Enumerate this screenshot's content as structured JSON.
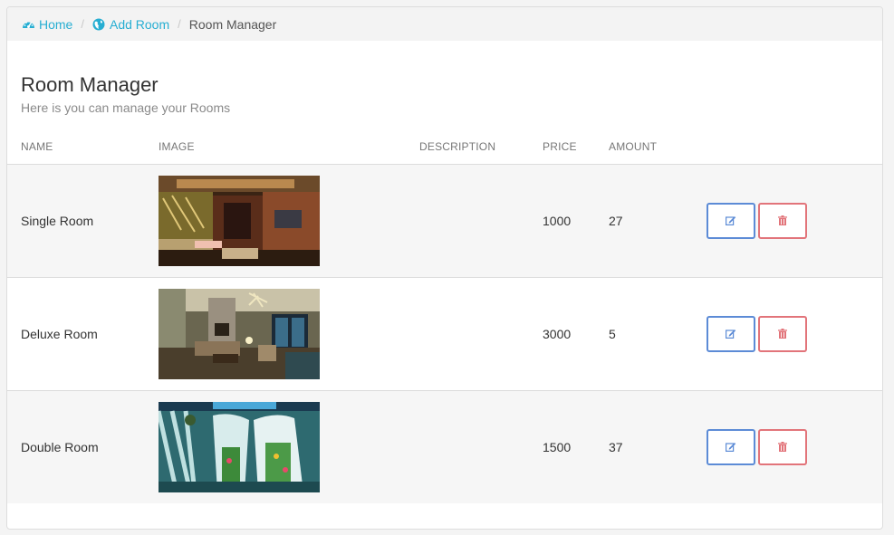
{
  "breadcrumb": {
    "home": "Home",
    "add_room": "Add Room",
    "current": "Room Manager"
  },
  "page": {
    "title": "Room Manager",
    "subtitle": "Here is you can manage your Rooms"
  },
  "table": {
    "columns": [
      "NAME",
      "IMAGE",
      "DESCRIPTION",
      "PRICE",
      "AMOUNT"
    ],
    "rows": [
      {
        "name": "Single Room",
        "description": "",
        "price": "1000",
        "amount": "27",
        "image": "single-room-photo"
      },
      {
        "name": "Deluxe Room",
        "description": "",
        "price": "3000",
        "amount": "5",
        "image": "deluxe-room-photo"
      },
      {
        "name": "Double Room",
        "description": "",
        "price": "1500",
        "amount": "37",
        "image": "double-room-photo"
      }
    ]
  },
  "icons": {
    "home": "dashboard-icon",
    "add_room": "globe-icon",
    "edit": "edit-icon",
    "delete": "trash-icon"
  },
  "colors": {
    "link": "#27aed2",
    "edit": "#5c8bd6",
    "delete": "#e2747a"
  }
}
